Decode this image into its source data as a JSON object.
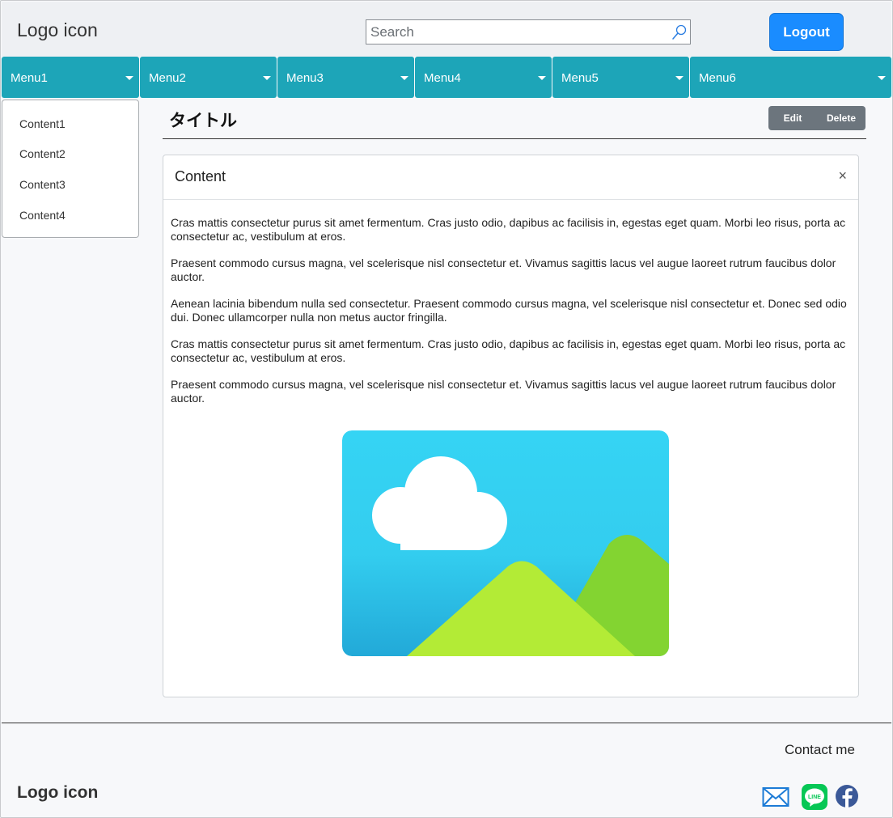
{
  "header": {
    "logo": "Logo icon",
    "search_placeholder": "Search",
    "search_value": "",
    "logout_label": "Logout"
  },
  "menu": [
    {
      "label": "Menu1"
    },
    {
      "label": "Menu2"
    },
    {
      "label": "Menu3"
    },
    {
      "label": "Menu4"
    },
    {
      "label": "Menu5"
    },
    {
      "label": "Menu6"
    }
  ],
  "dropdown": [
    "Content1",
    "Content2",
    "Content3",
    "Content4"
  ],
  "main": {
    "title": "タイトル",
    "edit_label": "Edit",
    "delete_label": "Delete"
  },
  "card": {
    "title": "Content",
    "close": "×",
    "paragraphs": [
      "Cras mattis consectetur purus sit amet fermentum. Cras justo odio, dapibus ac facilisis in, egestas eget quam. Morbi leo risus, porta ac consectetur ac, vestibulum at eros.",
      "Praesent commodo cursus magna, vel scelerisque nisl consectetur et. Vivamus sagittis lacus vel augue laoreet rutrum faucibus dolor auctor.",
      "Aenean lacinia bibendum nulla sed consectetur. Praesent commodo cursus magna, vel scelerisque nisl consectetur et. Donec sed odio dui. Donec ullamcorper nulla non metus auctor fringilla.",
      "Cras mattis consectetur purus sit amet fermentum. Cras justo odio, dapibus ac facilisis in, egestas eget quam. Morbi leo risus, porta ac consectetur ac, vestibulum at eros.",
      "Praesent commodo cursus magna, vel scelerisque nisl consectetur et. Vivamus sagittis lacus vel augue laoreet rutrum faucibus dolor auctor."
    ],
    "image_icon": "landscape-image-icon"
  },
  "footer": {
    "contact_label": "Contact me",
    "logo": "Logo icon",
    "social_icons": [
      "mail-icon",
      "line-icon",
      "facebook-icon"
    ],
    "line_text": "LINE"
  },
  "colors": {
    "menu_bg": "#1da5b8",
    "logout_bg": "#1a8cff",
    "btn_group_bg": "#6c757d",
    "header_bg": "#eef0f3"
  }
}
